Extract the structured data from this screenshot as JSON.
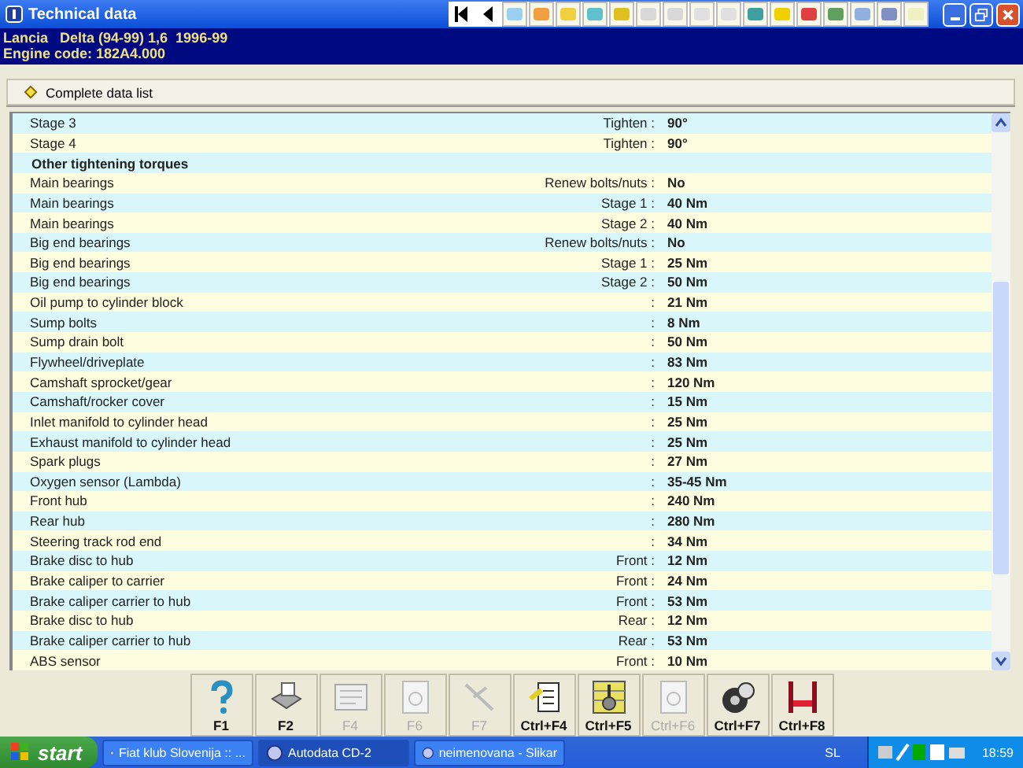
{
  "window": {
    "title": "Technical data"
  },
  "vehicle": {
    "line1": "Lancia   Delta (94-99) 1,6  1996-99",
    "line2": "Engine code: 182A4.000"
  },
  "section": {
    "title": "Complete data list"
  },
  "rows": [
    {
      "kind": "item",
      "label": "Stage 3",
      "qualifier": "Tighten :",
      "value": "90°"
    },
    {
      "kind": "item",
      "label": "Stage 4",
      "qualifier": "Tighten :",
      "value": "90°"
    },
    {
      "kind": "heading",
      "label": "Other tightening torques"
    },
    {
      "kind": "item",
      "label": "Main bearings",
      "qualifier": "Renew bolts/nuts :",
      "value": "No"
    },
    {
      "kind": "item",
      "label": "Main bearings",
      "qualifier": "Stage 1 :",
      "value": "40 Nm"
    },
    {
      "kind": "item",
      "label": "Main bearings",
      "qualifier": "Stage 2 :",
      "value": "40 Nm"
    },
    {
      "kind": "item",
      "label": "Big end bearings",
      "qualifier": "Renew bolts/nuts :",
      "value": "No"
    },
    {
      "kind": "item",
      "label": "Big end bearings",
      "qualifier": "Stage 1 :",
      "value": "25 Nm"
    },
    {
      "kind": "item",
      "label": "Big end bearings",
      "qualifier": "Stage 2 :",
      "value": "50 Nm"
    },
    {
      "kind": "item",
      "label": "Oil pump to cylinder block",
      "qualifier": ":",
      "value": "21 Nm"
    },
    {
      "kind": "item",
      "label": "Sump bolts",
      "qualifier": ":",
      "value": "8 Nm"
    },
    {
      "kind": "item",
      "label": "Sump drain bolt",
      "qualifier": ":",
      "value": "50 Nm"
    },
    {
      "kind": "item",
      "label": "Flywheel/driveplate",
      "qualifier": ":",
      "value": "83 Nm"
    },
    {
      "kind": "item",
      "label": "Camshaft sprocket/gear",
      "qualifier": ":",
      "value": "120 Nm"
    },
    {
      "kind": "item",
      "label": "Camshaft/rocker cover",
      "qualifier": ":",
      "value": "15 Nm"
    },
    {
      "kind": "item",
      "label": "Inlet manifold to cylinder head",
      "qualifier": ":",
      "value": "25 Nm"
    },
    {
      "kind": "item",
      "label": "Exhaust manifold to cylinder head",
      "qualifier": ":",
      "value": "25 Nm"
    },
    {
      "kind": "item",
      "label": "Spark plugs",
      "qualifier": ":",
      "value": "27 Nm"
    },
    {
      "kind": "item",
      "label": "Oxygen sensor (Lambda)",
      "qualifier": ":",
      "value": "35-45 Nm"
    },
    {
      "kind": "item",
      "label": "Front hub",
      "qualifier": ":",
      "value": "240 Nm"
    },
    {
      "kind": "item",
      "label": "Rear hub",
      "qualifier": ":",
      "value": "280 Nm"
    },
    {
      "kind": "item",
      "label": "Steering track rod end",
      "qualifier": ":",
      "value": "34 Nm"
    },
    {
      "kind": "item",
      "label": "Brake disc to hub",
      "qualifier": "Front :",
      "value": "12 Nm"
    },
    {
      "kind": "item",
      "label": "Brake caliper to carrier",
      "qualifier": "Front :",
      "value": "24 Nm"
    },
    {
      "kind": "item",
      "label": "Brake caliper carrier to hub",
      "qualifier": "Front :",
      "value": "53 Nm"
    },
    {
      "kind": "item",
      "label": "Brake disc to hub",
      "qualifier": "Rear :",
      "value": "12 Nm"
    },
    {
      "kind": "item",
      "label": "Brake caliper carrier to hub",
      "qualifier": "Rear :",
      "value": "53 Nm"
    },
    {
      "kind": "item",
      "label": "ABS sensor",
      "qualifier": "Front :",
      "value": "10 Nm"
    }
  ],
  "function_keys": [
    {
      "label": "F1",
      "kind": "help",
      "disabled": false
    },
    {
      "label": "F2",
      "kind": "print",
      "disabled": false
    },
    {
      "label": "F4",
      "kind": "list",
      "disabled": true
    },
    {
      "label": "F6",
      "kind": "document",
      "disabled": true
    },
    {
      "label": "F7",
      "kind": "tool",
      "disabled": true
    },
    {
      "label": "Ctrl+F4",
      "kind": "note",
      "disabled": false
    },
    {
      "label": "Ctrl+F5",
      "kind": "chart",
      "disabled": false
    },
    {
      "label": "Ctrl+F6",
      "kind": "document",
      "disabled": true
    },
    {
      "label": "Ctrl+F7",
      "kind": "wheel",
      "disabled": false
    },
    {
      "label": "Ctrl+F8",
      "kind": "lift",
      "disabled": false
    }
  ],
  "taskbar": {
    "start": "start",
    "tasks": [
      {
        "label": "Fiat klub Slovenija :: ...",
        "selected": false
      },
      {
        "label": "Autodata CD-2",
        "selected": true
      },
      {
        "label": "neimenovana - Slikar",
        "selected": false
      }
    ],
    "language": "SL",
    "clock": "18:59"
  }
}
